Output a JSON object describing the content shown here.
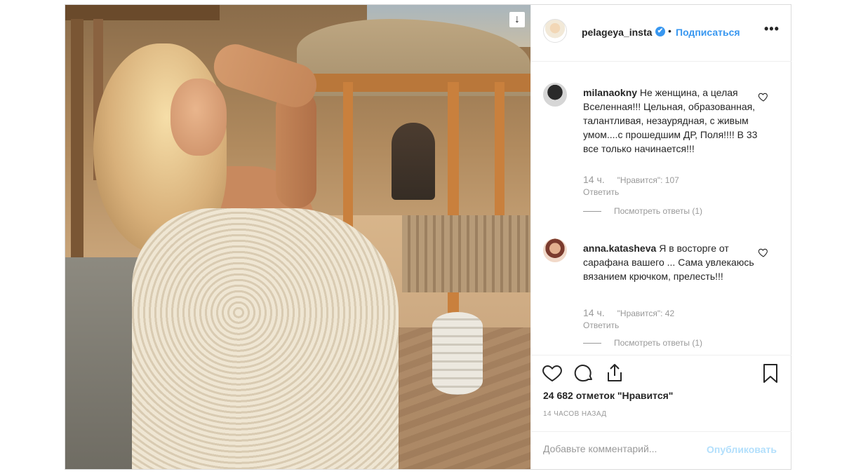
{
  "post": {
    "username": "pelageya_insta",
    "verified_badge": "✔",
    "separator": "•",
    "follow_label": "Подписаться",
    "more_label": "•••"
  },
  "comments": [
    {
      "username": "milanaokny",
      "text": "Не женщина, а целая Вселенная!!! Цельная, образованная, талантливая, незаурядная, с живым умом....с прошедшим ДР, Поля!!!! В 33 все только начинается!!!",
      "time": "14 ч.",
      "likes": "\"Нравится\": 107",
      "reply": "Ответить",
      "view_replies": "Посмотреть ответы (1)"
    },
    {
      "username": "anna.katasheva",
      "text": "Я в восторге от сарафана вашего ... Сама увлекаюсь вязанием крючком, прелесть!!!",
      "time": "14 ч.",
      "likes": "\"Нравится\": 42",
      "reply": "Ответить",
      "view_replies": "Посмотреть ответы (1)"
    }
  ],
  "stats": {
    "likes_label": "24 682 отметок \"Нравится\"",
    "time_ago": "14 ЧАСОВ НАЗАД"
  },
  "compose": {
    "placeholder": "Добавьте комментарий...",
    "publish_label": "Опубликовать"
  },
  "icons": {
    "download": "download-icon",
    "like": "heart-icon",
    "comment": "comment-icon",
    "share": "share-icon",
    "save": "bookmark-icon"
  },
  "colors": {
    "link_blue": "#3897f0",
    "muted": "#999999",
    "border": "#dbdbdb",
    "publish_disabled": "#b2dffc"
  }
}
